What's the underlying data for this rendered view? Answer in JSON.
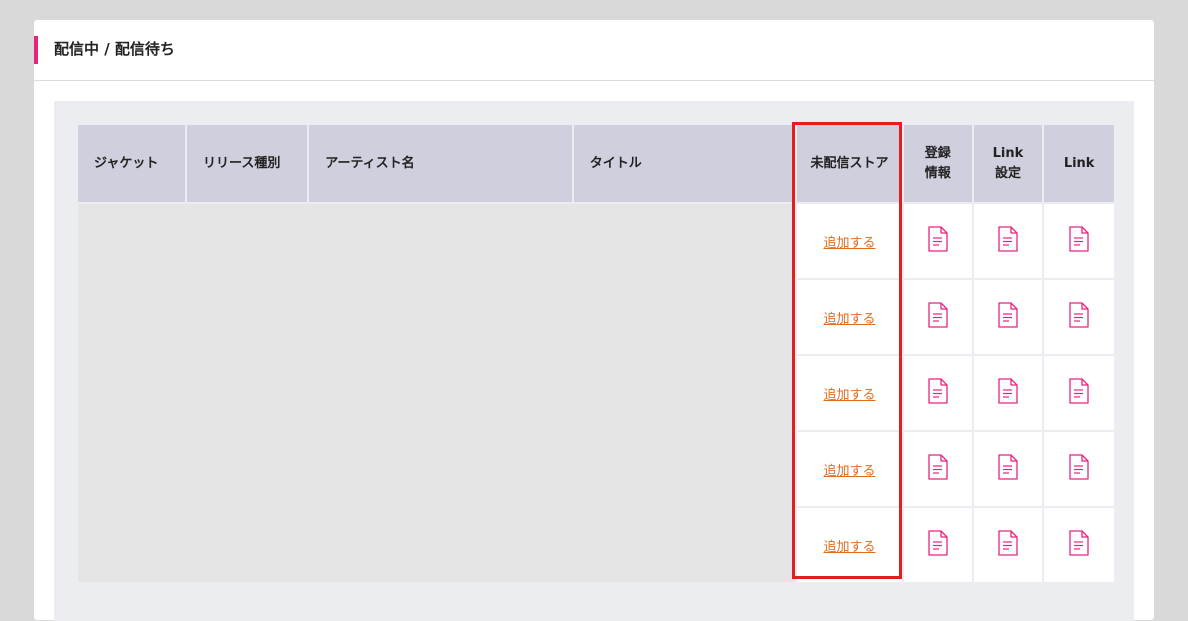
{
  "section": {
    "title": "配信中 / 配信待ち",
    "accent_color": "#e8237f"
  },
  "table": {
    "headers": {
      "jacket": "ジャケット",
      "release_type": "リリース種別",
      "artist": "アーティスト名",
      "title": "タイトル",
      "undelivered_store": "未配信ストア",
      "registration_line1": "登録",
      "registration_line2": "情報",
      "link_settings_line1": "Link",
      "link_settings_line2": "設定",
      "link": "Link"
    },
    "rows": [
      {
        "add_label": "追加する"
      },
      {
        "add_label": "追加する"
      },
      {
        "add_label": "追加する"
      },
      {
        "add_label": "追加する"
      },
      {
        "add_label": "追加する"
      }
    ]
  },
  "icons": {
    "document": "document-icon",
    "color": "#e8237f"
  },
  "highlight_color": "#e41e1e"
}
